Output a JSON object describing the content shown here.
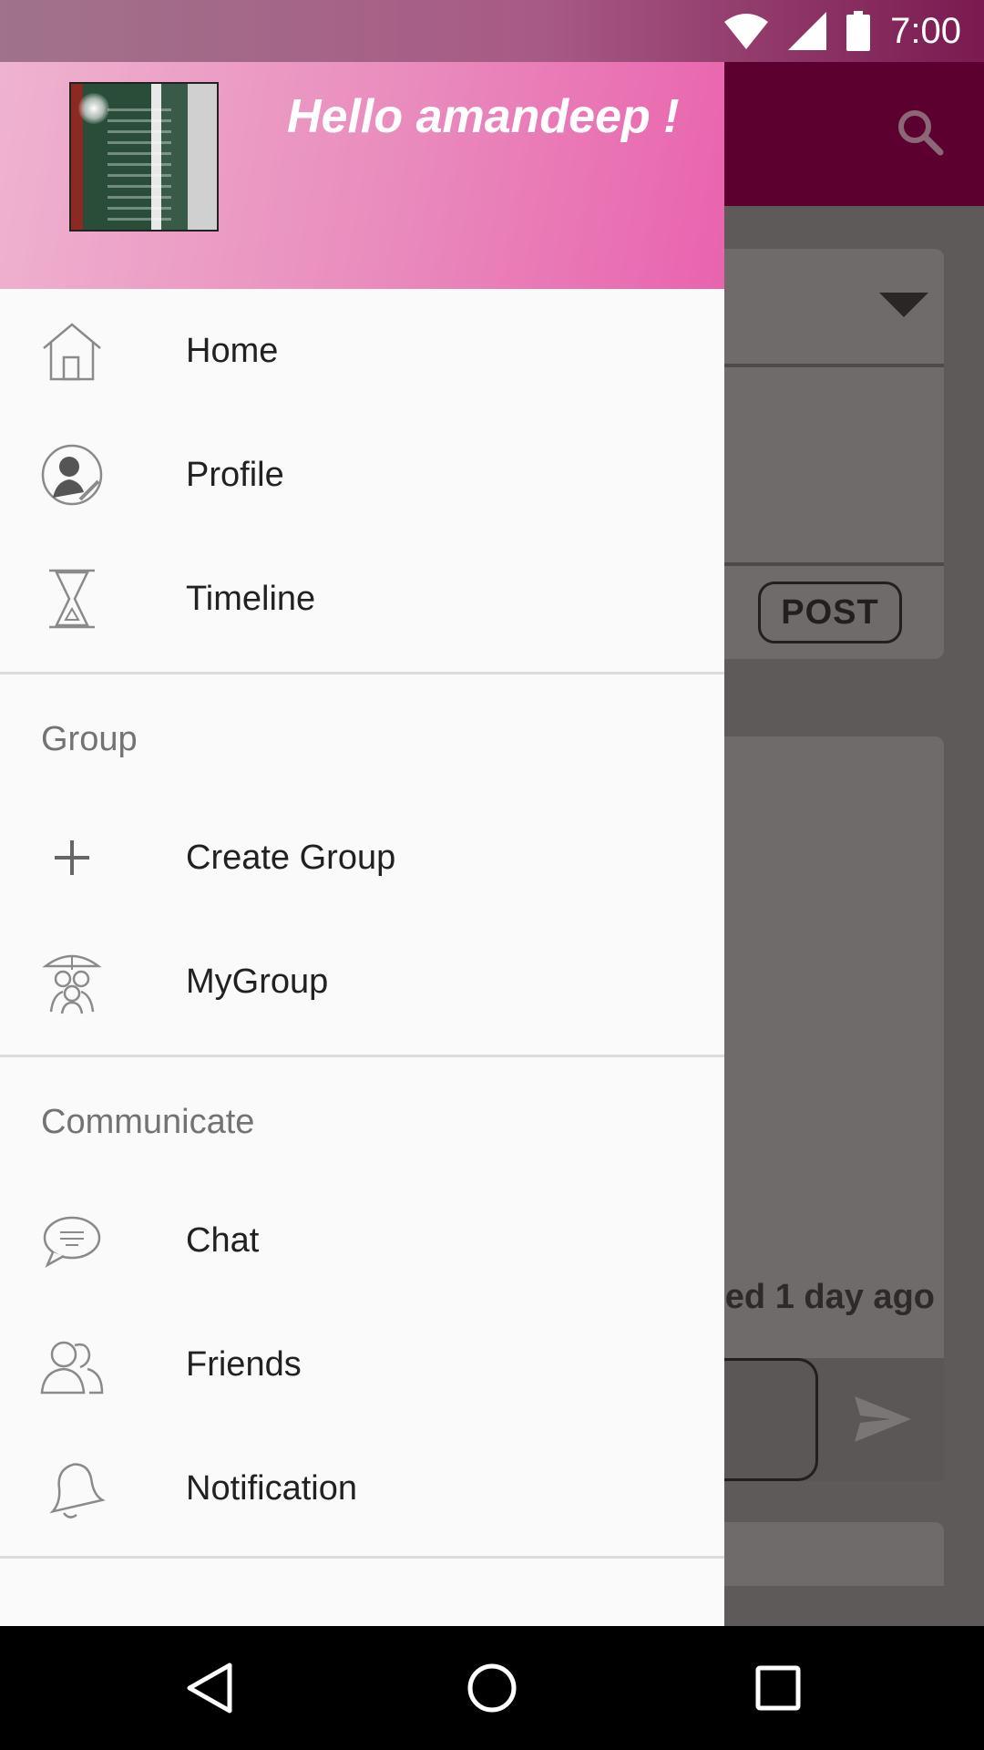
{
  "status_bar": {
    "time": "7:00"
  },
  "background_app": {
    "post_label": "POST",
    "posted_text": "ed 1 day ago"
  },
  "drawer": {
    "greeting": "Hello amandeep !",
    "items_main": [
      {
        "label": "Home",
        "icon": "home-icon"
      },
      {
        "label": "Profile",
        "icon": "profile-icon"
      },
      {
        "label": "Timeline",
        "icon": "hourglass-icon"
      }
    ],
    "group_section": {
      "title": "Group",
      "items": [
        {
          "label": "Create Group",
          "icon": "plus-icon"
        },
        {
          "label": "MyGroup",
          "icon": "group-icon"
        }
      ]
    },
    "communicate_section": {
      "title": "Communicate",
      "items": [
        {
          "label": "Chat",
          "icon": "chat-icon"
        },
        {
          "label": "Friends",
          "icon": "friends-icon"
        },
        {
          "label": "Notification",
          "icon": "bell-icon"
        }
      ]
    }
  },
  "colors": {
    "toolbar": "#5c0030",
    "drawer_header_start": "#efb3cf",
    "drawer_header_end": "#e963ae",
    "scrim": "#5f5a5a"
  }
}
